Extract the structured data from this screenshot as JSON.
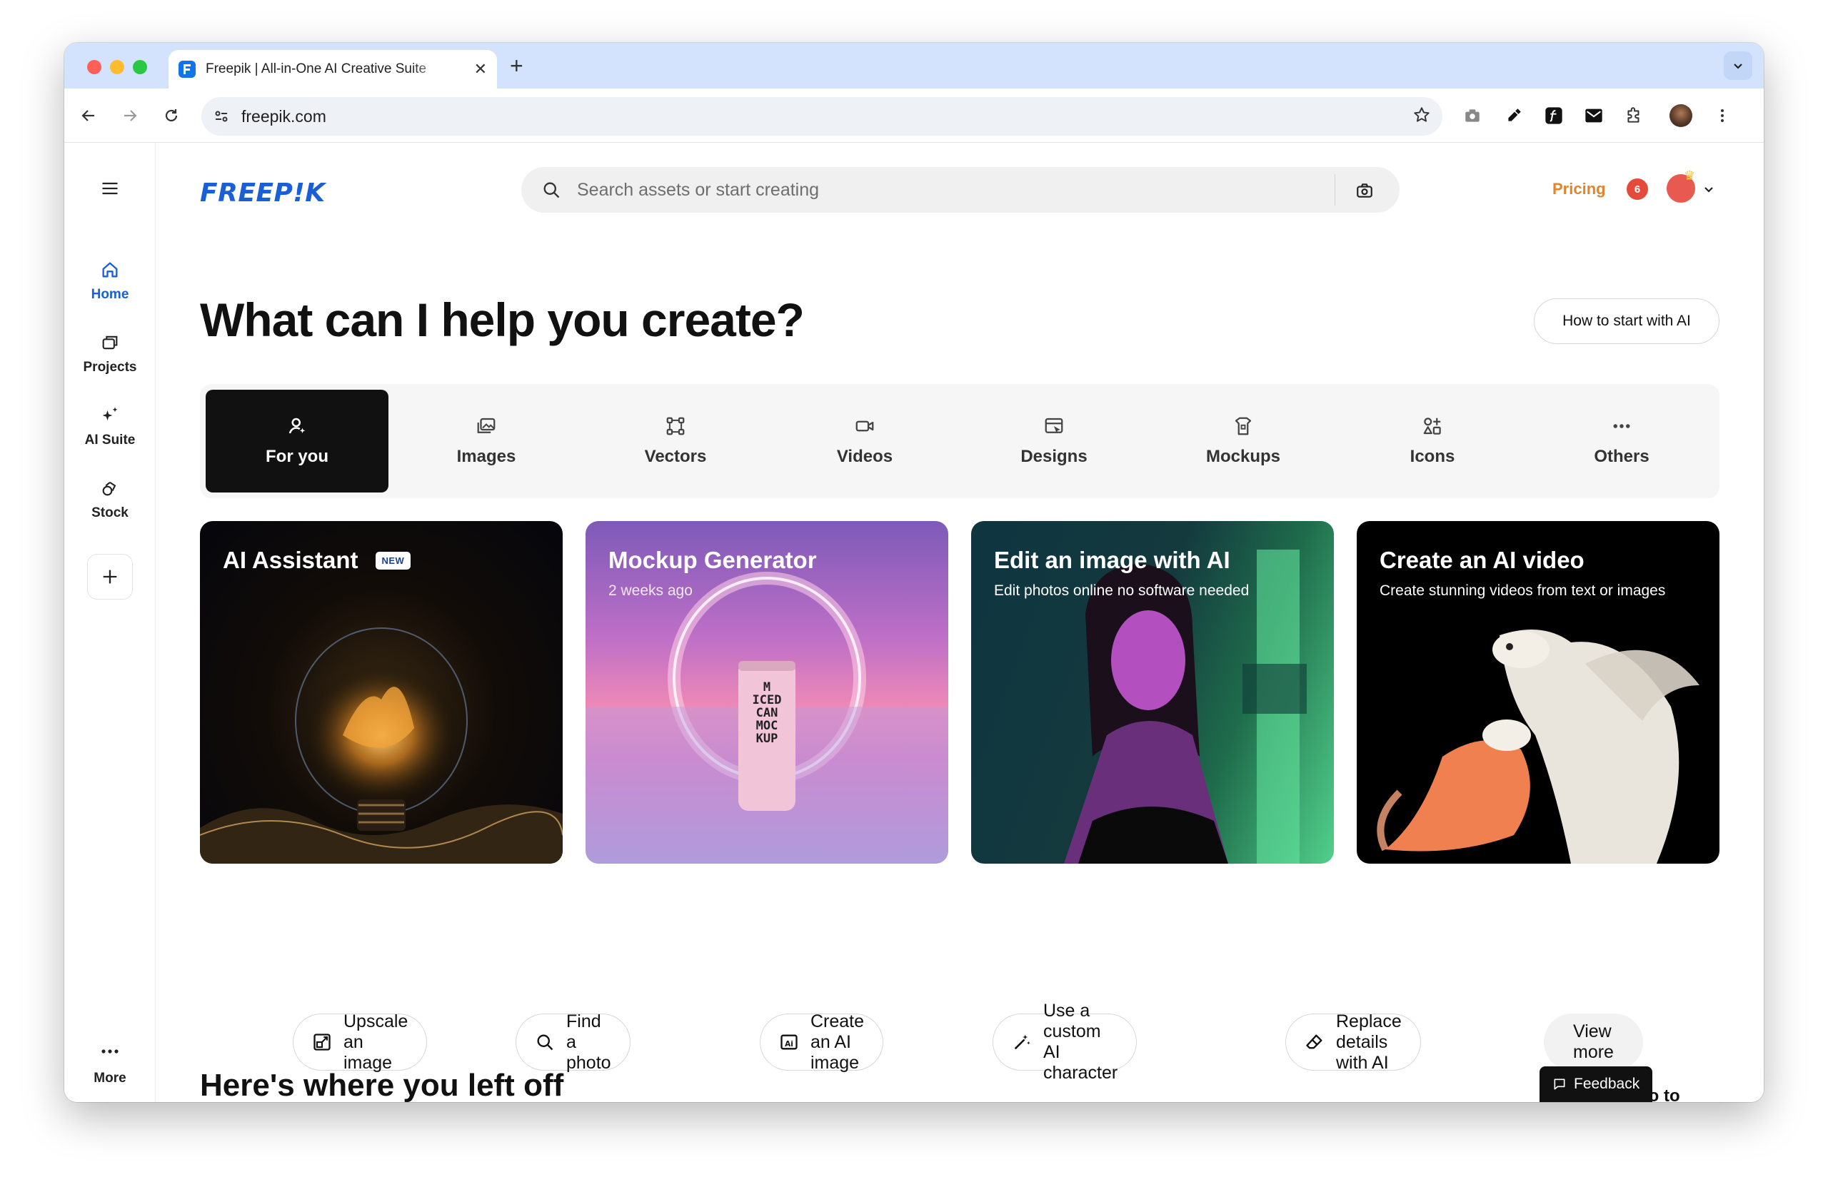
{
  "browser": {
    "tab_title": "Freepik | All-in-One AI Creative Suite",
    "url": "freepik.com",
    "close_glyph": "✕",
    "new_tab_glyph": "+"
  },
  "sidebar": {
    "items": [
      {
        "label": "Home",
        "icon": "home-icon"
      },
      {
        "label": "Projects",
        "icon": "projects-icon"
      },
      {
        "label": "AI Suite",
        "icon": "sparkle-icon"
      },
      {
        "label": "Stock",
        "icon": "stock-icon"
      }
    ],
    "more_label": "More"
  },
  "header": {
    "logo": "FREEP!K",
    "search_placeholder": "Search assets or start creating",
    "pricing": "Pricing",
    "notification_count": "6"
  },
  "main": {
    "headline": "What can I help you create?",
    "how_to_button": "How to start with AI",
    "categories": [
      {
        "label": "For you",
        "icon": "person-sparkle-icon"
      },
      {
        "label": "Images",
        "icon": "images-icon"
      },
      {
        "label": "Vectors",
        "icon": "vectors-icon"
      },
      {
        "label": "Videos",
        "icon": "video-icon"
      },
      {
        "label": "Designs",
        "icon": "designs-icon"
      },
      {
        "label": "Mockups",
        "icon": "mockups-icon"
      },
      {
        "label": "Icons",
        "icon": "icons-icon"
      },
      {
        "label": "Others",
        "icon": "more-dots-icon"
      }
    ],
    "cards": [
      {
        "title": "AI Assistant",
        "badge": "NEW",
        "subtitle": ""
      },
      {
        "title": "Mockup Generator",
        "subtitle": "2 weeks ago"
      },
      {
        "title": "Edit an image with AI",
        "subtitle": "Edit photos online no software needed"
      },
      {
        "title": "Create an AI video",
        "subtitle": "Create stunning videos from text or images"
      }
    ],
    "can_text": [
      "M",
      "ICED",
      "CAN",
      "MOC",
      "KUP"
    ],
    "actions": [
      {
        "label": "Upscale an image",
        "icon": "upscale-icon"
      },
      {
        "label": "Find a photo",
        "icon": "search-icon"
      },
      {
        "label": "Create an AI image",
        "icon": "ai-image-icon"
      },
      {
        "label": "Use a custom AI character",
        "icon": "magic-wand-icon"
      },
      {
        "label": "Replace details with AI",
        "icon": "eraser-icon"
      }
    ],
    "view_more": "View more",
    "section_title": "Here's where you left off",
    "goto_projects": "Go to Projects",
    "feedback": "Feedback"
  },
  "colors": {
    "brand": "#1a5fd6",
    "pricing": "#e2842b",
    "active_tab_bg": "#111111",
    "tab_strip": "#d3e3fd"
  }
}
